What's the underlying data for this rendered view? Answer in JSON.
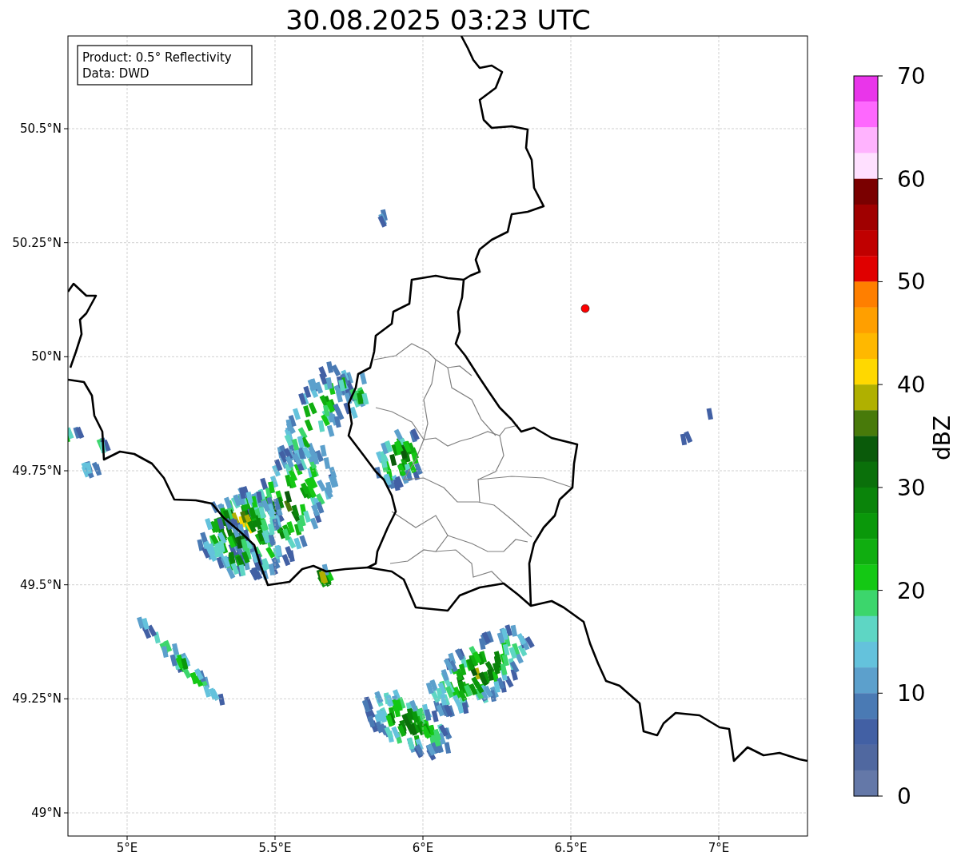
{
  "title": "30.08.2025 03:23 UTC",
  "info_box": [
    "Product: 0.5° Reflectivity",
    "Data: DWD"
  ],
  "y_ticks": [
    "50.5°N",
    "50.25°N",
    "50°N",
    "49.75°N",
    "49.5°N",
    "49.25°N",
    "49°N"
  ],
  "x_ticks": [
    "5°E",
    "5.5°E",
    "6°E",
    "6.5°E",
    "7°E"
  ],
  "colorbar": {
    "label": "dBZ",
    "ticks": [
      "70",
      "60",
      "50",
      "40",
      "30",
      "20",
      "10",
      "0"
    ],
    "segments": [
      {
        "color": "#e935ea"
      },
      {
        "color": "#fe68fe"
      },
      {
        "color": "#ffb3fe"
      },
      {
        "color": "#ffe0ff"
      },
      {
        "color": "#7a0000"
      },
      {
        "color": "#a00000"
      },
      {
        "color": "#c00000"
      },
      {
        "color": "#e00000"
      },
      {
        "color": "#ff7f00"
      },
      {
        "color": "#ff9f00"
      },
      {
        "color": "#ffb800"
      },
      {
        "color": "#ffd800"
      },
      {
        "color": "#b0b000"
      },
      {
        "color": "#487a0a"
      },
      {
        "color": "#0a5a0a"
      },
      {
        "color": "#0a700a"
      },
      {
        "color": "#0a840a"
      },
      {
        "color": "#0a980a"
      },
      {
        "color": "#10ae10"
      },
      {
        "color": "#14c814"
      },
      {
        "color": "#3cd66c"
      },
      {
        "color": "#5ed6c4"
      },
      {
        "color": "#64c2dc"
      },
      {
        "color": "#5ca0cc"
      },
      {
        "color": "#4a7ab4"
      },
      {
        "color": "#4260a4"
      },
      {
        "color": "#5068a0"
      },
      {
        "color": "#6478a8"
      }
    ]
  }
}
